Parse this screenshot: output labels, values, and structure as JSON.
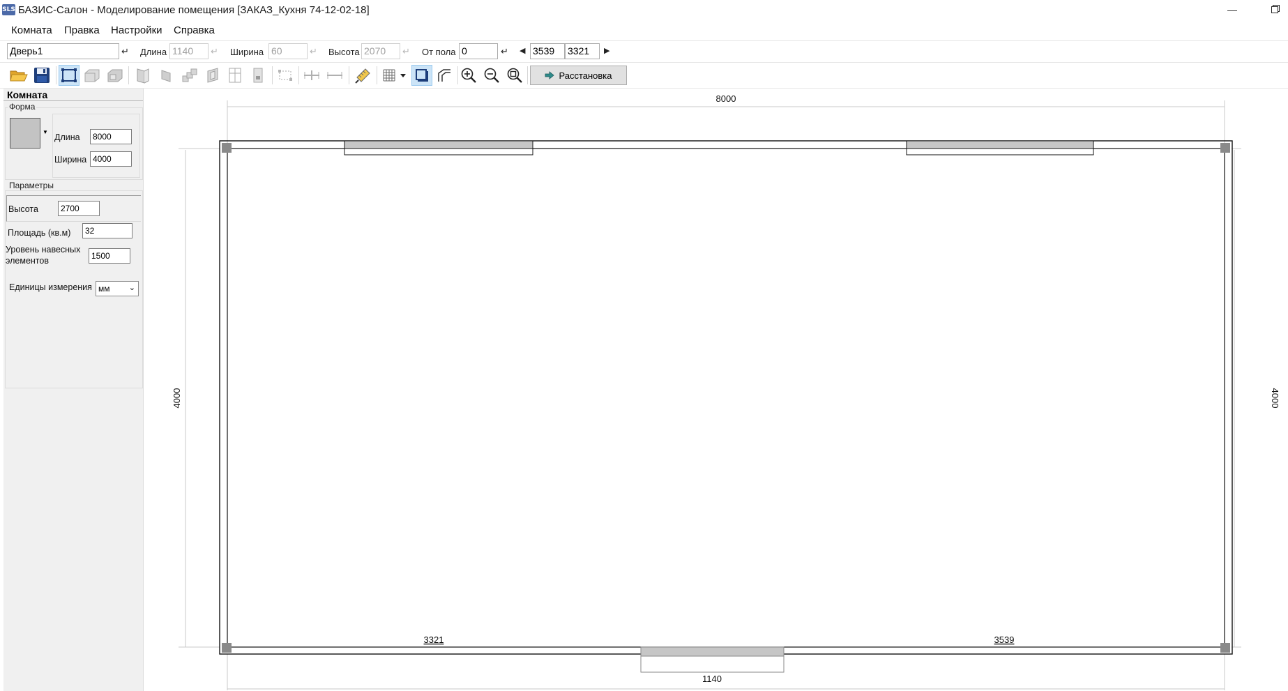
{
  "window": {
    "app_icon": "SLS",
    "title": "БАЗИС-Салон - Моделирование помещения [ЗАКАЗ_Кухня 74-12-02-18]",
    "minimize_icon": "minimize-icon",
    "restore_icon": "restore-icon"
  },
  "menu": [
    "Комната",
    "Правка",
    "Настройки",
    "Справка"
  ],
  "params_bar": {
    "name_value": "Дверь1",
    "length_label": "Длина",
    "length_value": "1140",
    "width_label": "Ширина",
    "width_value": "60",
    "height_label": "Высота",
    "height_value": "2070",
    "from_floor_label": "От пола",
    "from_floor_value": "0",
    "left_offset_value": "3539",
    "right_offset_value": "3321"
  },
  "toolbar": {
    "icons": [
      "open-folder-icon",
      "save-icon",
      "room-plan-icon",
      "wall-icon",
      "wall-3d-icon",
      "door-icon",
      "window-icon",
      "stairs-icon",
      "niche-icon",
      "column-icon",
      "socket-icon",
      "dimension-icon",
      "add-element-icon",
      "remove-element-icon",
      "ruler-pencil-icon",
      "grid-icon",
      "outline-icon",
      "corner-icon",
      "zoom-in-icon",
      "zoom-out-icon",
      "zoom-fit-icon"
    ],
    "arrange_label": "Расстановка",
    "arrange_icon": "arrow-right-icon"
  },
  "left_panel": {
    "title": "Комната",
    "shape_group": "Форма",
    "length_label": "Длина",
    "length_value": "8000",
    "width_label": "Ширина",
    "width_value": "4000",
    "params_group": "Параметры",
    "height_label": "Высота",
    "height_value": "2700",
    "area_label": "Площадь (кв.м)",
    "area_value": "32",
    "level_label_1": "Уровень навесных",
    "level_label_2": "элементов",
    "level_value": "1500",
    "units_label": "Единицы измерения",
    "units_value": "мм"
  },
  "plan": {
    "top_dim": "8000",
    "left_dim": "4000",
    "right_dim": "4000",
    "bottom_left_dim": "3321",
    "bottom_right_dim": "3539",
    "door_dim": "1140"
  },
  "colors": {
    "selection_bg": "#cce4f7",
    "opening_fill": "#c6c6c6",
    "panel_bg": "#f0f0f0",
    "corner_fill": "#8a8a8a"
  }
}
